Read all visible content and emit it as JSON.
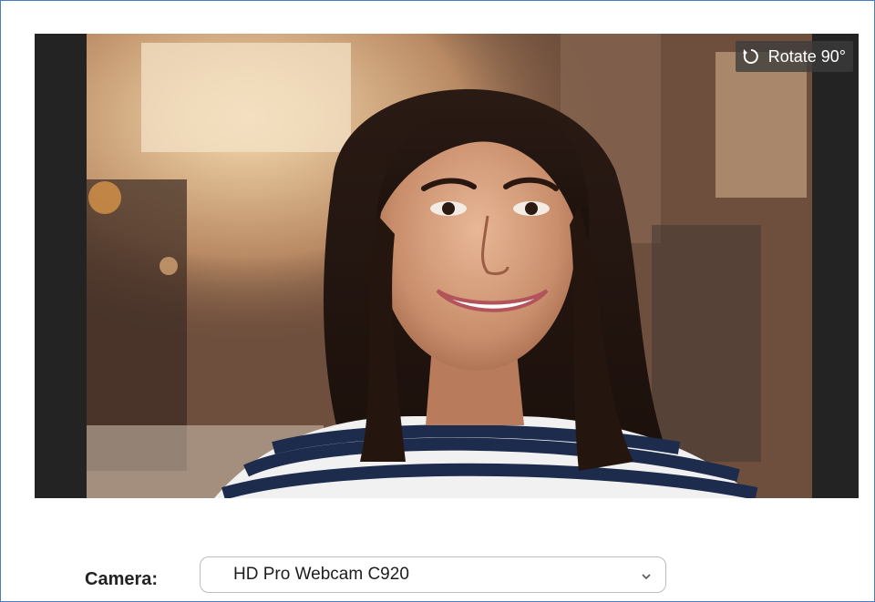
{
  "preview": {
    "rotate_label": "Rotate 90°",
    "rotate_icon": "rotate-icon"
  },
  "camera": {
    "label": "Camera:",
    "selected": "HD Pro Webcam C920",
    "dropdown_icon": "chevron-down-icon"
  },
  "colors": {
    "frame_border": "#4a7fb8",
    "preview_letterbox": "#232323",
    "rotate_button_bg": "#3c3c3c"
  }
}
